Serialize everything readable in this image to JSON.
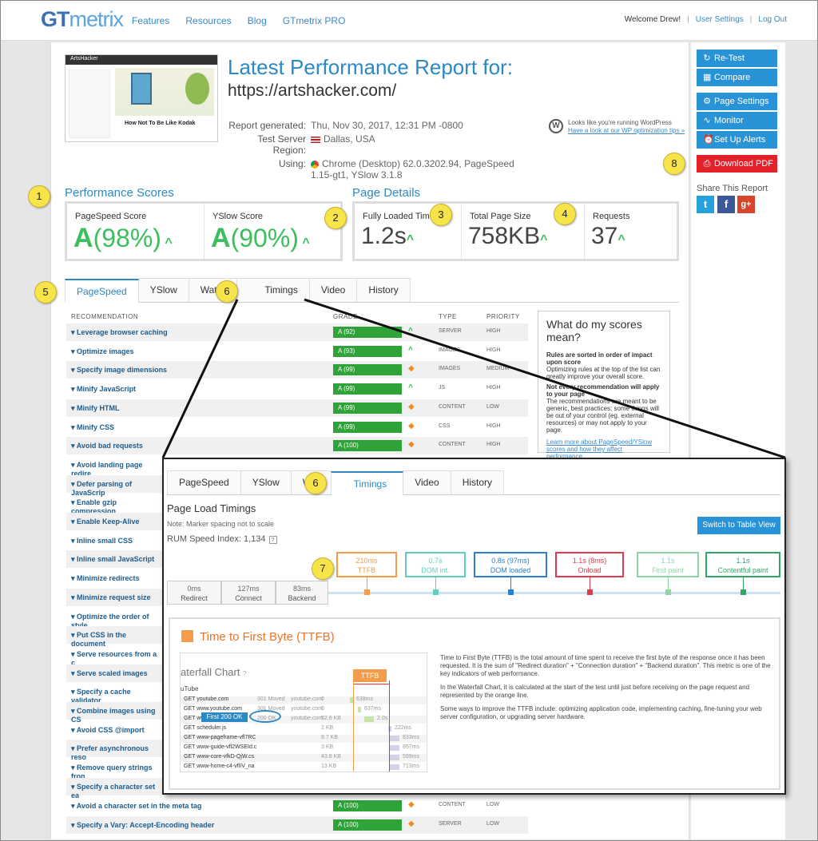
{
  "header": {
    "logo": {
      "gt": "GT",
      "mx": "metrix"
    },
    "nav": [
      "Features",
      "Resources",
      "Blog",
      "GTmetrix PRO"
    ],
    "welcome": "Welcome Drew!",
    "user_settings": "User Settings",
    "logout": "Log Out"
  },
  "report": {
    "title": "Latest Performance Report for:",
    "url": "https://artshacker.com/",
    "meta": [
      {
        "label": "Report generated:",
        "value": "Thu, Nov 30, 2017, 12:31 PM -0800"
      },
      {
        "label": "Test Server Region:",
        "value": "Dallas, USA"
      },
      {
        "label": "Using:",
        "value": "Chrome (Desktop) 62.0.3202.94, PageSpeed 1.15-gt1, YSlow 3.1.8"
      }
    ],
    "wp_line1": "Looks like you're running WordPress",
    "wp_line2": "Have a look at our WP optimization tips »"
  },
  "thumbnail": {
    "brand": "ArtsHacker",
    "caption": "How Not To Be Like Kodak"
  },
  "scores": {
    "title": "Performance Scores",
    "pagespeed": {
      "label": "PageSpeed Score",
      "grade": "A",
      "pct": "(98%)"
    },
    "yslow": {
      "label": "YSlow Score",
      "grade": "A",
      "pct": "(90%)"
    }
  },
  "details": {
    "title": "Page Details",
    "loaded": {
      "label": "Fully Loaded Time",
      "value": "1.2s"
    },
    "size": {
      "label": "Total Page Size",
      "value": "758KB"
    },
    "requests": {
      "label": "Requests",
      "value": "37"
    }
  },
  "sidebar": {
    "retest": "Re-Test",
    "compare": "Compare",
    "page_settings": "Page Settings",
    "monitor": "Monitor",
    "alerts": "Set Up Alerts",
    "pdf": "Download PDF",
    "share": "Share This Report"
  },
  "tabs": [
    "PageSpeed",
    "YSlow",
    "Waterfall",
    "Timings",
    "Video",
    "History"
  ],
  "tabs_visible": [
    "PageSpeed",
    "YSlow",
    "Water",
    "Timings",
    "Video",
    "History"
  ],
  "recs_header": {
    "rec": "RECOMMENDATION",
    "grade": "GRADE",
    "type": "TYPE",
    "priority": "PRIORITY"
  },
  "recs_top": [
    {
      "name": "Leverage browser caching",
      "grade": "A (92)",
      "trend": "up",
      "type": "SERVER",
      "priority": "HIGH"
    },
    {
      "name": "Optimize images",
      "grade": "A (93)",
      "trend": "up",
      "type": "IMAGES",
      "priority": "HIGH"
    },
    {
      "name": "Specify image dimensions",
      "grade": "A (99)",
      "trend": "same",
      "type": "IMAGES",
      "priority": "MEDIUM"
    },
    {
      "name": "Minify JavaScript",
      "grade": "A (99)",
      "trend": "up",
      "type": "JS",
      "priority": "HIGH"
    },
    {
      "name": "Minify HTML",
      "grade": "A (99)",
      "trend": "same",
      "type": "CONTENT",
      "priority": "LOW"
    },
    {
      "name": "Minify CSS",
      "grade": "A (99)",
      "trend": "same",
      "type": "CSS",
      "priority": "HIGH"
    },
    {
      "name": "Avoid bad requests",
      "grade": "A (100)",
      "trend": "same",
      "type": "CONTENT",
      "priority": "HIGH"
    }
  ],
  "recs_cut": [
    "Avoid landing page redire",
    "Defer parsing of JavaScrip",
    "Enable gzip compression",
    "Enable Keep-Alive",
    "Inline small CSS",
    "Inline small JavaScript",
    "Minimize redirects",
    "Minimize request size",
    "Optimize the order of style",
    "Put CSS in the document",
    "Serve resources from a c",
    "Serve scaled images",
    "Specify a cache validator",
    "Combine images using CS",
    "Avoid CSS @import",
    "Prefer asynchronous reso",
    "Remove query strings fron",
    "Specify a character set ea"
  ],
  "recs_bottom": [
    {
      "name": "Avoid a character set in the meta tag",
      "grade": "A (100)",
      "trend": "same",
      "type": "CONTENT",
      "priority": "LOW"
    },
    {
      "name": "Specify a Vary: Accept-Encoding header",
      "grade": "A (100)",
      "trend": "same",
      "type": "SERVER",
      "priority": "LOW"
    }
  ],
  "what_scores": {
    "title": "What do my scores mean?",
    "b1": "Rules are sorted in order of impact upon score",
    "p1": "Optimizing rules at the top of the list can greatly improve your overall score.",
    "b2": "Not every recommendation will apply to your page",
    "p2": "The recommendations are meant to be generic, best practices; some things will be out of your control (eg. external resources) or may not apply to your page.",
    "link": "Learn more about PageSpeed/YSlow scores and how they affect performance."
  },
  "timings": {
    "tabs": [
      "PageSpeed",
      "YSlow",
      "Wat",
      "Timings",
      "Video",
      "History"
    ],
    "title": "Page Load Timings",
    "note": "Note: Marker spacing not to scale",
    "rum_label": "RUM Speed Index:",
    "rum_value": "1,134",
    "switch": "Switch to Table View",
    "markers": [
      {
        "time": "210ms",
        "label": "TTFB",
        "color": "#f39c4a"
      },
      {
        "time": "0.7s",
        "label": "DOM int.",
        "color": "#5fd0c0"
      },
      {
        "time": "0.8s (97ms)",
        "label": "DOM loaded",
        "color": "#2b7fd0"
      },
      {
        "time": "1.1s (8ms)",
        "label": "Onload",
        "color": "#e23b4a"
      },
      {
        "time": "1.1s",
        "label": "First paint",
        "color": "#8fd6a4"
      },
      {
        "time": "1.1s",
        "label": "Contentful paint",
        "color": "#2fa866"
      }
    ],
    "phases": [
      {
        "time": "0ms",
        "label": "Redirect"
      },
      {
        "time": "127ms",
        "label": "Connect"
      },
      {
        "time": "83ms",
        "label": "Backend"
      }
    ]
  },
  "ttfb": {
    "title": "Time to First Byte (TTFB)",
    "label": "TTFB",
    "desc": [
      "Time to First Byte (TTFB) is the total amount of time spent to receive the first byte of the response once it has been requested. It is the sum of \"Redirect duration\" + \"Connection duration\" + \"Backend duration\". This metric is one of the key indicators of web performance.",
      "In the Waterfall Chart, it is calculated at the start of the test until just before receiving on the page request and represented by the orange line.",
      "Some ways to improve the TTFB include: optimizing application code, implementing caching, fine-tuning your web server configuration, or upgrading server hardware."
    ],
    "wf_title": "aterfall Chart",
    "wf_sub": "uTube",
    "first200": "First 200 OK",
    "rows": [
      {
        "url": "GET youtube.com",
        "status": "301 Moved",
        "domain": "youtube.com",
        "size": "0",
        "time": "638ms"
      },
      {
        "url": "GET www.youtube.com",
        "status": "301 Moved",
        "domain": "youtube.com",
        "size": "0",
        "time": "637ms"
      },
      {
        "url": "GET www",
        "status": "200 OK",
        "domain": "youtube.com",
        "size": "52.6 KB",
        "time": "2.0s"
      },
      {
        "url": "GET scheduler.js",
        "status": "",
        "domain": "",
        "size": "2 KB",
        "time": "222ms"
      },
      {
        "url": "GET www-pageframe-vfl7RC",
        "status": "",
        "domain": "",
        "size": "8.7 KB",
        "time": "833ms"
      },
      {
        "url": "GET www-guide-vfl2WSEId.c",
        "status": "",
        "domain": "",
        "size": "3 KB",
        "time": "857ms"
      },
      {
        "url": "GET www-core-vfkD-QjW.cs",
        "status": "",
        "domain": "",
        "size": "43.8 KB",
        "time": "599ms"
      },
      {
        "url": "GET www-home-c4-vflIV_na",
        "status": "",
        "domain": "",
        "size": "13 KB",
        "time": "713ms"
      }
    ]
  },
  "callouts": [
    "1",
    "2",
    "3",
    "4",
    "5",
    "6",
    "6",
    "7",
    "8"
  ]
}
